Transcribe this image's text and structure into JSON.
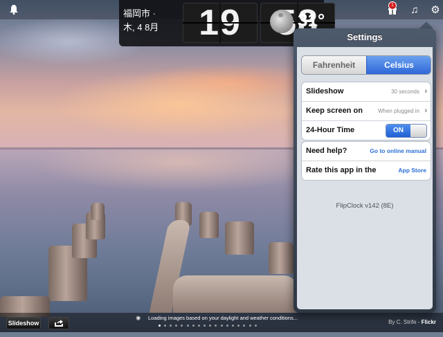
{
  "colors": {
    "accent": "#2e67d6",
    "link": "#2a6fd6",
    "toggle_on": "#1f5fd2",
    "badge": "#d01818"
  },
  "topbar": {
    "bell_icon": "bell-icon",
    "city_line1": "福岡市 ·",
    "city_line2": "木, 4 8月",
    "hours": "19",
    "minutes": "58",
    "weather_icon": "moon-cloud-icon",
    "temperature": "31°",
    "icons": [
      "gift-icon",
      "music-note-icon",
      "gear-icon"
    ],
    "badge_count": "1"
  },
  "settings": {
    "title": "Settings",
    "units": {
      "options": [
        "Fahrenheit",
        "Celsius"
      ],
      "selected": "Celsius"
    },
    "rows": [
      {
        "label": "Slideshow",
        "value": "30 seconds"
      },
      {
        "label": "Keep screen on",
        "value": "When plugged in"
      },
      {
        "label": "24-Hour Time",
        "toggle": "ON",
        "toggle_state": true
      }
    ],
    "help_rows": [
      {
        "label": "Need help?",
        "link": "Go to online manual"
      },
      {
        "label": "Rate this app in the",
        "link": "App Store"
      }
    ],
    "version": "FlipClock v142 (8E)"
  },
  "bottombar": {
    "slideshow_button": "Slideshow",
    "share_icon": "share-arrow-icon",
    "loading_text": "Loading images based on your daylight and weather conditions...",
    "credit_prefix": "By C. Strife -",
    "credit_source": "Flickr",
    "page_dots": {
      "count": 18,
      "active_index": 0
    }
  }
}
